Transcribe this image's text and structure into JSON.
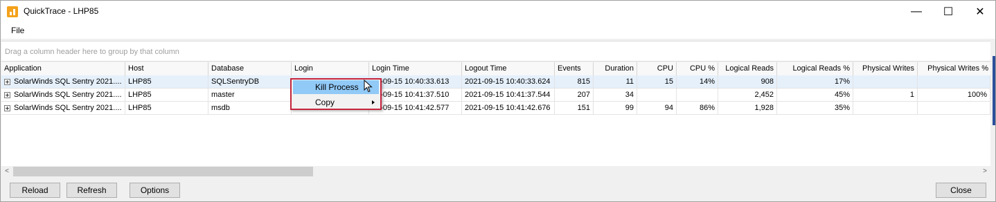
{
  "window": {
    "title": "QuickTrace - LHP85"
  },
  "menu": {
    "file": "File"
  },
  "groupbar": {
    "hint": "Drag a column header here to group by that column"
  },
  "columns": [
    "Application",
    "Host",
    "Database",
    "Login",
    "Login Time",
    "Logout Time",
    "Events",
    "Duration",
    "CPU",
    "CPU %",
    "Logical Reads",
    "Logical Reads %",
    "Physical Writes",
    "Physical Writes %"
  ],
  "rows": [
    {
      "application": "SolarWinds SQL Sentry 2021....",
      "host": "LHP85",
      "database": "SQLSentryDB",
      "login": "",
      "login_time": "21-09-15 10:40:33.613",
      "logout_time": "2021-09-15 10:40:33.624",
      "events": "815",
      "duration": "11",
      "cpu": "15",
      "cpu_pct": "14%",
      "logical_reads": "908",
      "logical_reads_pct": "17%",
      "physical_writes": "",
      "physical_writes_pct": ""
    },
    {
      "application": "SolarWinds SQL Sentry 2021....",
      "host": "LHP85",
      "database": "master",
      "login": "",
      "login_time": "21-09-15 10:41:37.510",
      "logout_time": "2021-09-15 10:41:37.544",
      "events": "207",
      "duration": "34",
      "cpu": "",
      "cpu_pct": "",
      "logical_reads": "2,452",
      "logical_reads_pct": "45%",
      "physical_writes": "1",
      "physical_writes_pct": "100%"
    },
    {
      "application": "SolarWinds SQL Sentry 2021....",
      "host": "LHP85",
      "database": "msdb",
      "login": "",
      "login_time": "21-09-15 10:41:42.577",
      "logout_time": "2021-09-15 10:41:42.676",
      "events": "151",
      "duration": "99",
      "cpu": "94",
      "cpu_pct": "86%",
      "logical_reads": "1,928",
      "logical_reads_pct": "35%",
      "physical_writes": "",
      "physical_writes_pct": ""
    }
  ],
  "context_menu": {
    "kill_process": "Kill Process",
    "copy": "Copy"
  },
  "buttons": {
    "reload": "Reload",
    "refresh": "Refresh",
    "options": "Options",
    "close": "Close"
  },
  "window_controls": {
    "minimize": "—",
    "maximize": "☐",
    "close": "✕"
  },
  "scroll": {
    "left": "<",
    "right": ">"
  }
}
